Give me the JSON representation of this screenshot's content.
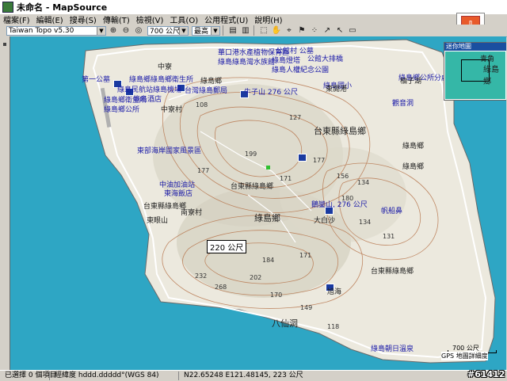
{
  "window": {
    "title": "未命名 - MapSource"
  },
  "menu": [
    "檔案(F)",
    "編輯(E)",
    "搜尋(S)",
    "傳輸(T)",
    "檢視(V)",
    "工具(O)",
    "公用程式(U)",
    "說明(H)"
  ],
  "toolbar": {
    "map_product": "Taiwan Topo v5.30",
    "zoom_level": "700 公尺",
    "detail_level": "最高"
  },
  "map": {
    "poi_labels": [
      "華口港水產植物保育區",
      "公館村 公墓",
      "綠島綠島灣水族館",
      "綠島燈塔",
      "公館大排橋",
      "綠島人權紀念公園",
      "中寮",
      "綠島鄉綠島鄉衛生所",
      "第一公墓",
      "綠島民航站綠島機場",
      "台灣綠島郵局",
      "綠島鄉公所",
      "綠島鄉",
      "綠島鄉衛生所",
      "綠島國小",
      "中寮村",
      "綠島酒店",
      "東開港",
      "牛子山 276 公尺",
      "綠島鄉公所分處",
      "台東縣綠島鄉",
      "柚子湖",
      "觀音洞",
      "東部海岸國家風景區",
      "南寮村",
      "綠島鄉",
      "東海飯店",
      "中油加油站",
      "東眼山",
      "台東縣綠島鄉",
      "綠島鄉",
      "鵝鑾山, 276 公尺",
      "綠島鄉",
      "大白沙",
      "帆船鼻",
      "台東縣綠島鄉",
      "旭海",
      "綠島朝日溫泉",
      "八仙洞",
      "台東縣綠島鄉"
    ],
    "callout": "220 公尺",
    "contour_values": [
      "108",
      "127",
      "177",
      "199",
      "171",
      "156",
      "134",
      "180",
      "134",
      "177",
      "232",
      "268",
      "202",
      "184",
      "171",
      "131",
      "170",
      "149",
      "118"
    ],
    "scale": {
      "distance": "700 公尺",
      "note": "GPS 地圖詳細度"
    },
    "overview": {
      "title": "迷你地圖",
      "label1": "青角",
      "label2": "綠島鄉"
    }
  },
  "status": {
    "selection": "已選擇 0 個項目",
    "coord_format": "經緯度 hddd.ddddd°(WGS 84)",
    "cursor": "N22.65248 E121.48145, 223 公尺"
  },
  "watermark": "#61412",
  "colors": {
    "sea": "#2ea6c4",
    "land": "#e8e8e0",
    "contour": "#b87850",
    "road": "#ffffff"
  }
}
